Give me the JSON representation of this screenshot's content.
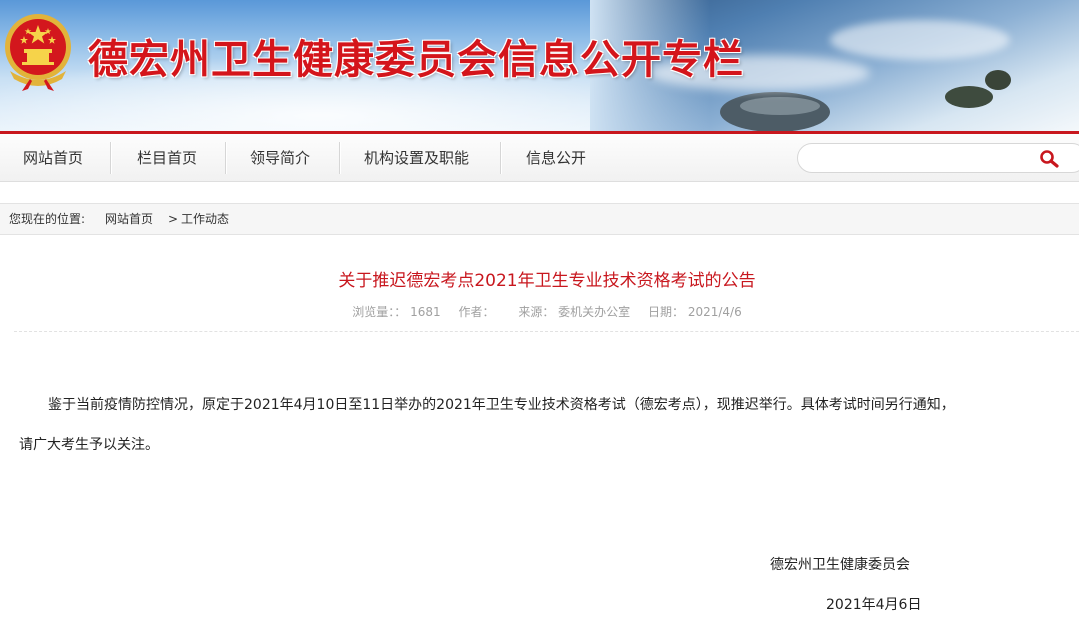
{
  "header": {
    "site_title": "德宏州卫生健康委员会信息公开专栏",
    "emblem": "national-emblem-icon"
  },
  "nav": {
    "items": [
      {
        "label": "网站首页"
      },
      {
        "label": "栏目首页"
      },
      {
        "label": "领导简介"
      },
      {
        "label": "机构设置及职能"
      },
      {
        "label": "信息公开"
      }
    ],
    "search": {
      "value": "",
      "placeholder": "",
      "icon": "search-icon"
    }
  },
  "breadcrumb": {
    "prefix": "您现在的位置:",
    "home": "网站首页",
    "separator": ">",
    "current": "工作动态"
  },
  "article": {
    "title": "关于推迟德宏考点2021年卫生专业技术资格考试的公告",
    "meta": {
      "views_label": "浏览量：：",
      "views": "1681",
      "author_label": "作者：",
      "source_label": "来源：",
      "source": "委机关办公室",
      "date_label": "日期：",
      "date": "2021/4/6"
    },
    "body_line1": "鉴于当前疫情防控情况，原定于2021年4月10日至11日举办的2021年卫生专业技术资格考试（德宏考点），现推迟举行。具体考试时间另行通知，",
    "body_line2": "请广大考生予以关注。",
    "signature": "德宏州卫生健康委员会",
    "sign_date": "2021年4月6日"
  },
  "colors": {
    "accent_red": "#c8171e",
    "meta_gray": "#a0a0a0"
  }
}
